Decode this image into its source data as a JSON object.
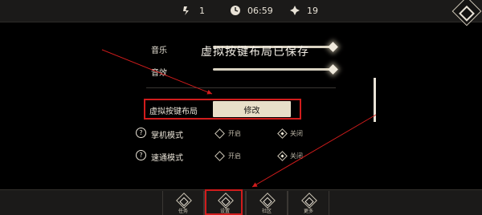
{
  "topbar": {
    "stats": [
      {
        "icon": "stamina-icon",
        "value": "1"
      },
      {
        "icon": "clock-icon",
        "value": "06:59"
      },
      {
        "icon": "crystal-icon",
        "value": "19"
      }
    ],
    "corner_icon": "menu-diamond-icon"
  },
  "settings": {
    "music_label": "音乐",
    "music_level": 1.0,
    "sfx_label": "音效",
    "sfx_level": 1.0,
    "toast": "虚拟按键布局已保存",
    "layout_label": "虚拟按键布局",
    "edit_button": "修改",
    "handheld_label": "掌机模式",
    "handheld_on": "开启",
    "handheld_off": "关闭",
    "handheld_selected": "off",
    "quick_label": "速通模式",
    "quick_on": "开启",
    "quick_off": "关闭",
    "quick_selected": "off",
    "help_glyph": "?"
  },
  "bottom_nav": [
    {
      "label": "任务",
      "icon": "quest-icon"
    },
    {
      "label": "设置",
      "icon": "settings-icon",
      "active": true
    },
    {
      "label": "社区",
      "icon": "community-icon"
    },
    {
      "label": "更多",
      "icon": "more-icon"
    }
  ],
  "annotation_color": "#d11c1c"
}
